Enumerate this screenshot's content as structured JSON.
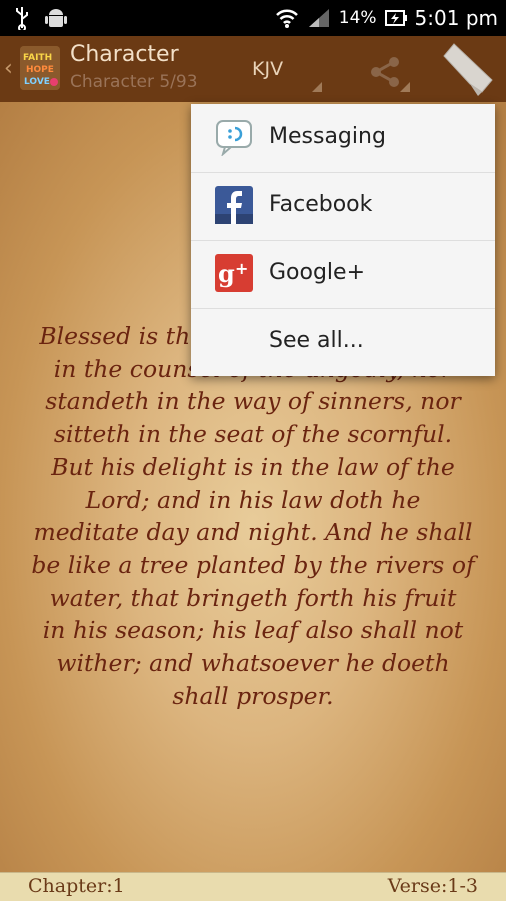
{
  "status_bar": {
    "battery": "14%",
    "time": "5:01 pm",
    "icons": [
      "usb-icon",
      "android-icon",
      "wifi-icon",
      "signal-icon",
      "battery-icon"
    ]
  },
  "action_bar": {
    "title": "Character",
    "subtitle": "Character 5/93",
    "version": "KJV",
    "icons": [
      "app-logo-icon",
      "share-icon",
      "bookmark-icon"
    ]
  },
  "content": {
    "lines": [
      "Blessed is the man that walketh not",
      "in the counsel of the ungodly, nor",
      "standeth in the way of sinners, nor",
      "sitteth in the seat of the scornful.",
      "But his delight is in the law of the",
      "Lord; and in his law doth he",
      "meditate day and night. And he shall",
      "be like a tree planted by the rivers of",
      "water, that bringeth forth his fruit",
      "in his season; his leaf also shall not",
      "wither; and whatsoever he doeth",
      "shall prosper."
    ]
  },
  "footer": {
    "chapter": "Chapter:1",
    "verse": "Verse:1-3"
  },
  "share_menu": {
    "items": [
      {
        "label": "Messaging",
        "icon": "messaging-icon"
      },
      {
        "label": "Facebook",
        "icon": "facebook-icon"
      },
      {
        "label": "Google+",
        "icon": "google-plus-icon"
      },
      {
        "label": "See all...",
        "icon": ""
      }
    ]
  },
  "colors": {
    "action_bar": "#6b3a14",
    "verse_text": "#6a2410",
    "footer_bg": "#e9dcae",
    "menu_bg": "#f5f5f5"
  }
}
